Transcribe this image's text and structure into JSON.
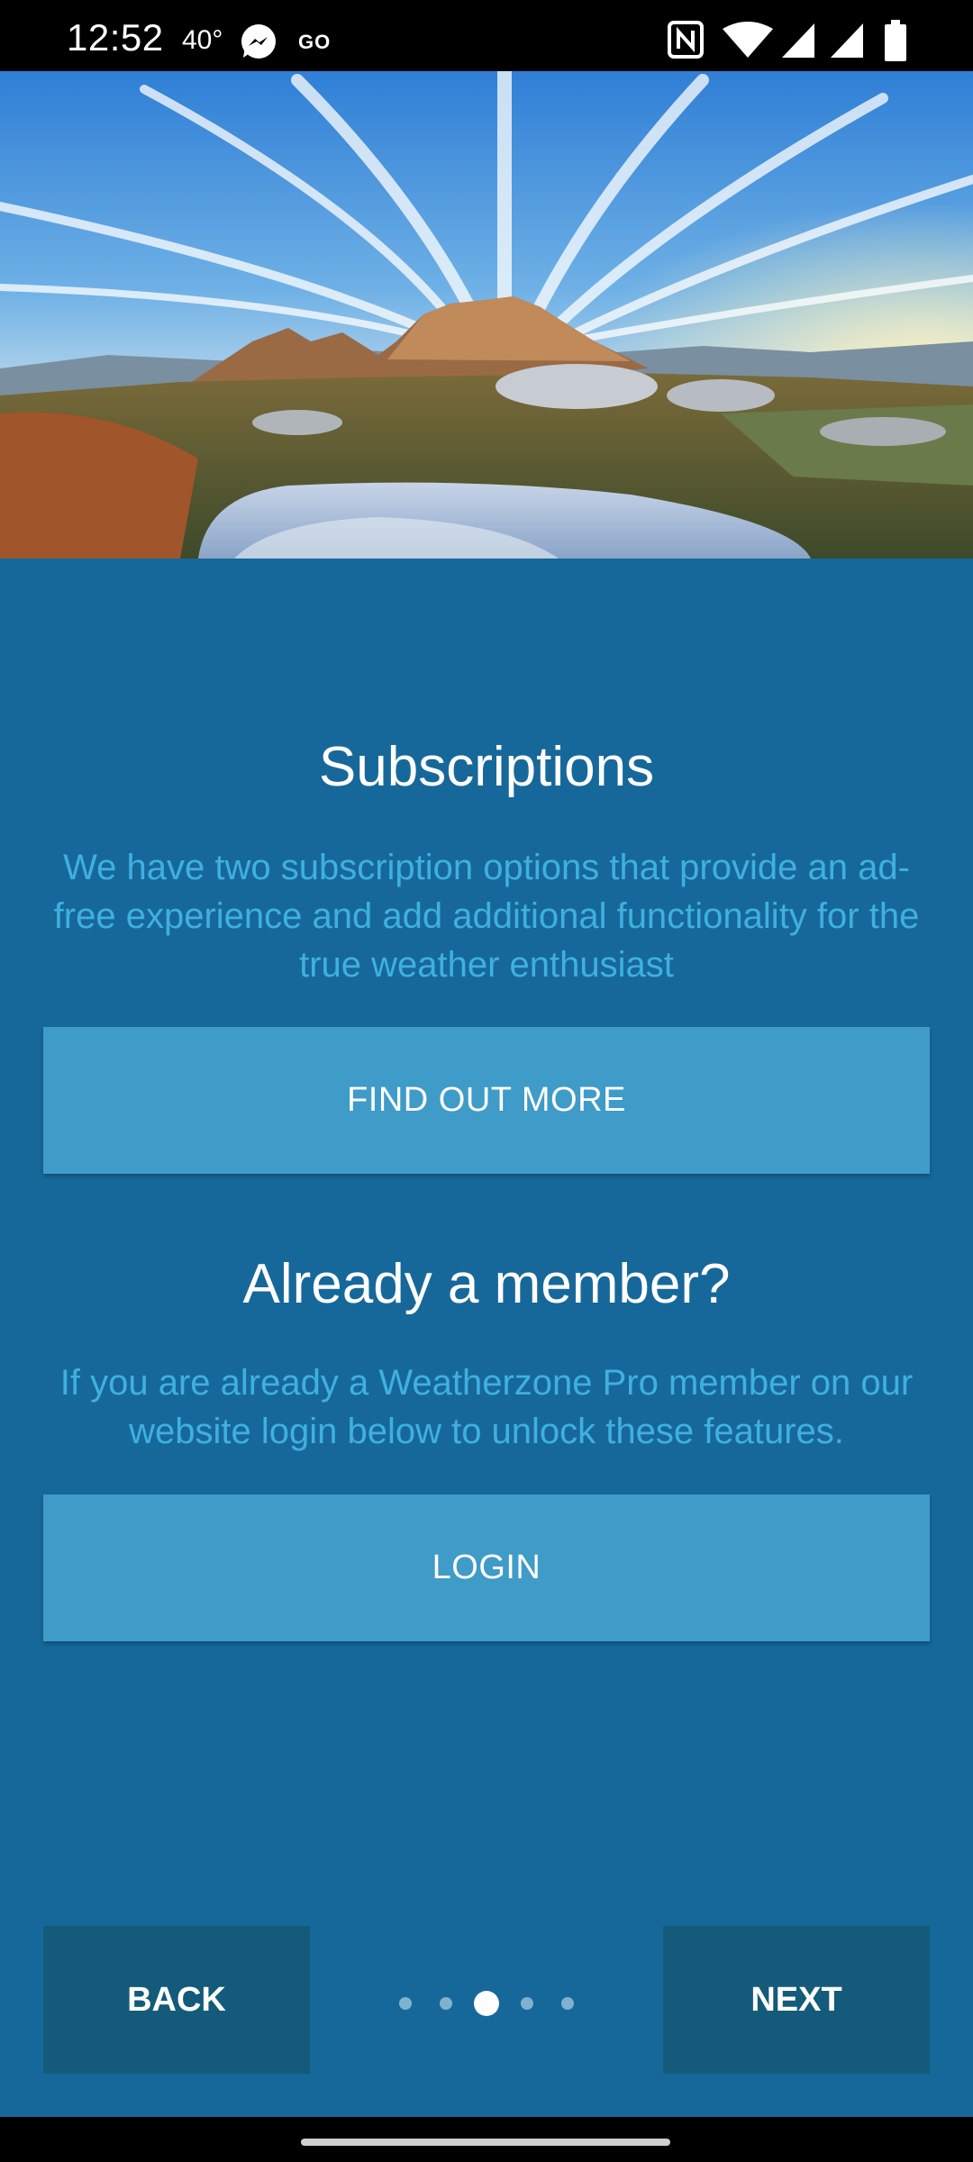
{
  "status_bar": {
    "time": "12:52",
    "temperature": "40°",
    "go_label": "GO",
    "icons": [
      "messenger-icon",
      "nfc-icon",
      "wifi-icon",
      "signal-icon",
      "signal-icon",
      "battery-icon"
    ]
  },
  "hero": {
    "image": "mountain-landscape-sunrise"
  },
  "subscriptions": {
    "title": "Subscriptions",
    "description": "We have two subscription options that provide an ad-free experience and add additional functionality for the true weather enthusiast",
    "button_label": "FIND OUT MORE"
  },
  "member": {
    "title": "Already a member?",
    "description": "If you are already a Weatherzone Pro member on our website login below to unlock these features.",
    "button_label": "LOGIN"
  },
  "navigation": {
    "back_label": "BACK",
    "next_label": "NEXT",
    "page_count": 5,
    "current_page": 3
  },
  "colors": {
    "panel": "#17689a",
    "button": "#3f9bc8",
    "nav_button": "#145a7a",
    "text_accent": "#3fb0e0"
  }
}
